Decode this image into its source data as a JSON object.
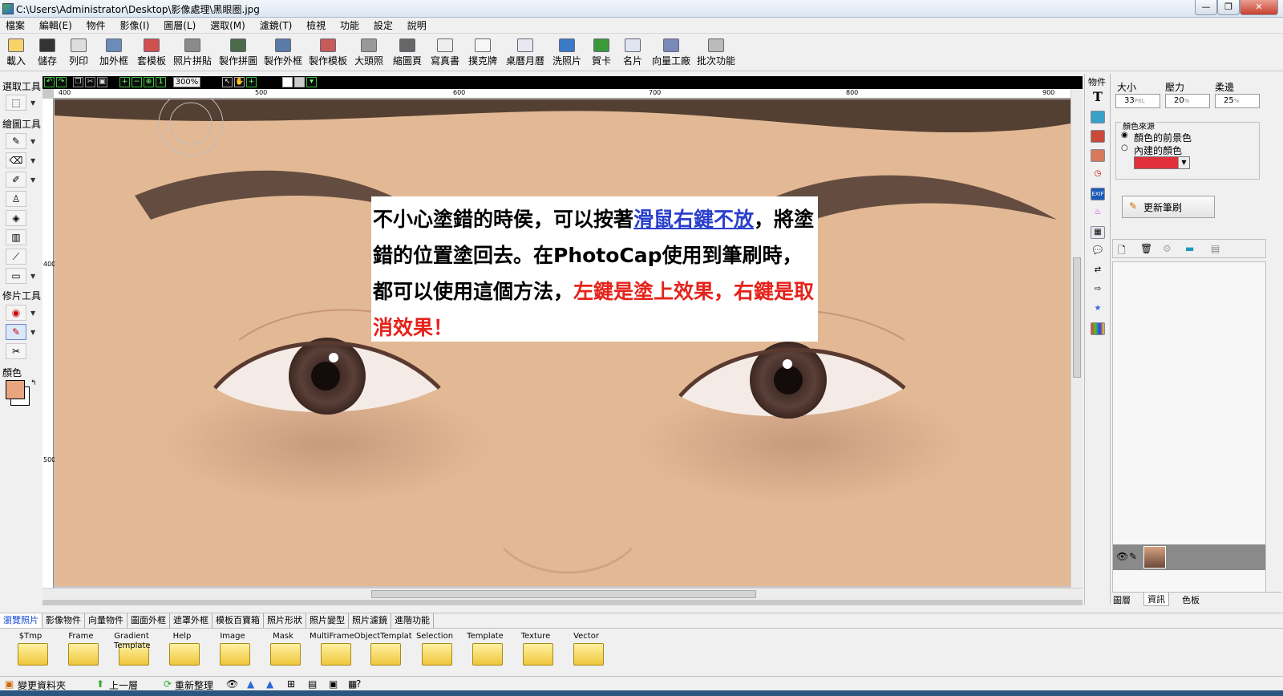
{
  "window": {
    "title": "C:\\Users\\Administrator\\Desktop\\影像處理\\黑眼圈.jpg",
    "minimize_glyph": "—",
    "maximize_glyph": "❐",
    "close_glyph": "✕"
  },
  "menu": [
    "檔案",
    "編輯(E)",
    "物件",
    "影像(I)",
    "圖層(L)",
    "選取(M)",
    "濾鏡(T)",
    "檢視",
    "功能",
    "設定",
    "說明"
  ],
  "toolbar": [
    {
      "label": "載入",
      "icon": "folder-open-icon"
    },
    {
      "label": "儲存",
      "icon": "floppy-icon"
    },
    {
      "label": "列印",
      "icon": "printer-icon"
    },
    {
      "label": "加外框",
      "icon": "frame-icon"
    },
    {
      "label": "套模板",
      "icon": "template-icon"
    },
    {
      "label": "照片拼貼",
      "icon": "collage-icon"
    },
    {
      "label": "製作拼圖",
      "icon": "puzzle-icon"
    },
    {
      "label": "製作外框",
      "icon": "make-frame-icon"
    },
    {
      "label": "製作模板",
      "icon": "make-template-icon"
    },
    {
      "label": "大頭照",
      "icon": "id-photo-icon"
    },
    {
      "label": "縮圖頁",
      "icon": "thumbnail-page-icon"
    },
    {
      "label": "寫真書",
      "icon": "photo-book-icon"
    },
    {
      "label": "撲克牌",
      "icon": "poker-card-icon"
    },
    {
      "label": "桌曆月曆",
      "icon": "calendar-icon"
    },
    {
      "label": "洗照片",
      "icon": "print-photo-icon"
    },
    {
      "label": "賀卡",
      "icon": "greeting-card-icon"
    },
    {
      "label": "名片",
      "icon": "business-card-icon"
    },
    {
      "label": "向量工廠",
      "icon": "vector-factory-icon"
    },
    {
      "label": "批次功能",
      "icon": "batch-icon"
    }
  ],
  "left_panel": {
    "select_tools": "選取工具",
    "draw_tools": "繪圖工具",
    "retouch_tools": "修片工具",
    "color_label": "顏色",
    "foreground_color": "#e8a580",
    "background_color": "#ffffff"
  },
  "canvas": {
    "zoom": "300%",
    "ruler_h": [
      "400",
      "500",
      "600",
      "700",
      "800",
      "900"
    ],
    "ruler_v": [
      "400",
      "500"
    ],
    "note": {
      "part1": "不小心塗錯的時侯，可以按著",
      "link": "滑鼠右鍵不放",
      "part2": "，將塗錯的位置塗回去。在PhotoCap使用到筆刷時，都可以使用這個方法，",
      "red": "左鍵是塗上效果，右鍵是取消效果！"
    }
  },
  "object_panel": {
    "title": "物件",
    "text_tool": "T"
  },
  "right_panel": {
    "size_label": "大小",
    "pressure_label": "壓力",
    "edge_label": "柔邊",
    "size_value": "33",
    "size_unit": "PXL",
    "pressure_value": "20",
    "pressure_unit": "%",
    "edge_value": "25",
    "edge_unit": "%",
    "color_source_label": "顏色來源",
    "radio_fg": "顏色的前景色",
    "radio_builtin": "內建的顏色",
    "builtin_color": "#e0303a",
    "update_brush": "更新筆刷",
    "tabs": [
      "圖層",
      "資訊",
      "色板"
    ]
  },
  "bottom_tabs": [
    "瀏覽照片",
    "影像物件",
    "向量物件",
    "圖面外框",
    "遮罩外框",
    "模板百寶箱",
    "照片形狀",
    "照片變型",
    "照片濾鏡",
    "進階功能"
  ],
  "folders": [
    "$Tmp",
    "Frame",
    "Gradient Template",
    "Help",
    "Image",
    "Mask",
    "MultiFrameObjectTemplat",
    "Selection",
    "Template",
    "Texture",
    "Vector"
  ],
  "statusbar": {
    "change_folder": "變更資料夾",
    "up": "上一層",
    "refresh": "重新整理",
    "help": "?"
  }
}
